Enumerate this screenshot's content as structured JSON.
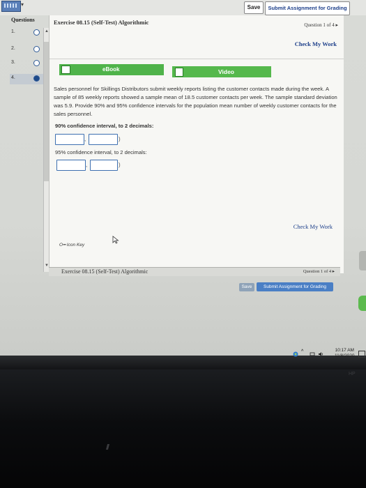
{
  "toolbar": {
    "save_label": "Save",
    "submit_label": "Submit Assignment for Grading"
  },
  "questions": {
    "header": "Questions",
    "items": [
      {
        "number": "1.",
        "state": "empty"
      },
      {
        "number": "2.",
        "state": "empty"
      },
      {
        "number": "3.",
        "state": "empty"
      },
      {
        "number": "4.",
        "state": "current"
      }
    ]
  },
  "exercise": {
    "title": "Exercise 08.15 (Self-Test) Algorithmic",
    "question_of": "Question 1 of 4",
    "check_my_work": "Check My Work"
  },
  "resources": {
    "ebook_label": "eBook",
    "video_label": "Video"
  },
  "problem": {
    "text": "Sales personnel for Skillings Distributors submit weekly reports listing the customer contacts made during the week. A sample of 85 weekly reports showed a sample mean of 18.5 customer contacts per week. The sample standard deviation was 5.9. Provide 90% and 95% confidence intervals for the population mean number of weekly customer contacts for the sales personnel.",
    "ci90_label": "90% confidence interval, to 2 decimals:",
    "ci95_label": "95% confidence interval, to 2 decimals:",
    "ci90_values": [
      "",
      ""
    ],
    "ci95_values": [
      "",
      ""
    ],
    "comma": ",",
    "close_paren": ")",
    "icon_key": "Icon Key"
  },
  "footer": {
    "title": "Exercise 08.15 (Self-Test) Algorithmic",
    "question_of": "Question 1 of 4",
    "save_label": "Save",
    "submit_label": "Submit Assignment for Grading"
  },
  "taskbar": {
    "time": "10:17 AM",
    "date": "11/8/2020"
  },
  "monitor_brand": "HP",
  "colors": {
    "accent_green": "#4fb34a",
    "link_blue": "#1d3f8a",
    "submit_blue": "#4a7fc5"
  }
}
